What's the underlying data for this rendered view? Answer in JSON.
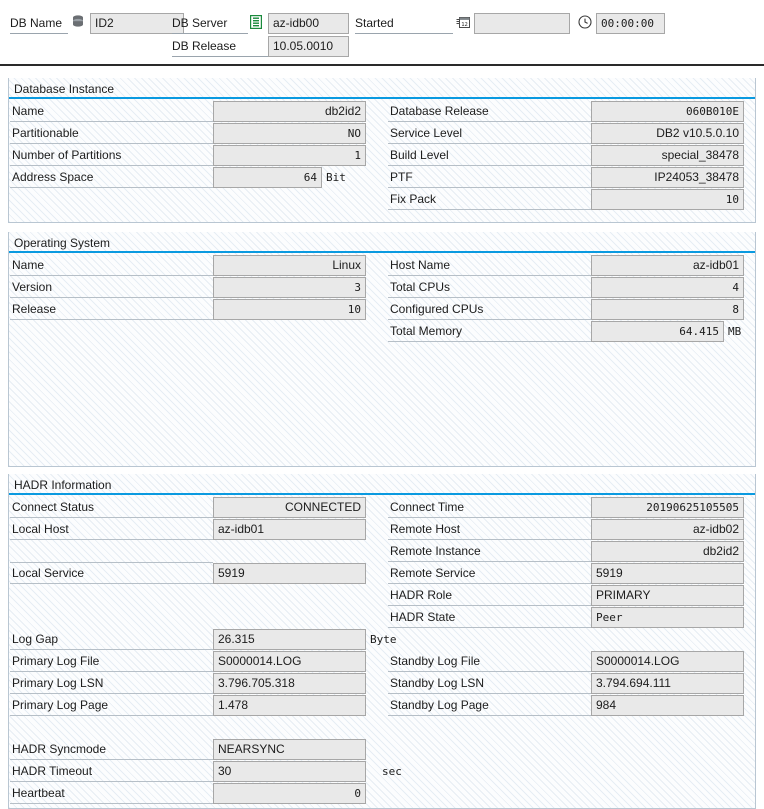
{
  "header": {
    "db_name_label": "DB Name",
    "db_name_icon": "database-icon",
    "db_name_value": "ID2",
    "db_server_label": "DB Server",
    "db_server_icon": "server-icon",
    "db_server_value": "az-idb00",
    "db_release_label": "DB Release",
    "db_release_value": "10.05.0010",
    "started_label": "Started",
    "started_icon": "calendar-icon",
    "started_date_value": "",
    "started_time_icon": "clock-icon",
    "started_time_value": "00:00:00"
  },
  "panels": [
    {
      "title": "Database Instance",
      "left_rows": [
        {
          "label": "Name",
          "value": "db2id2",
          "unit": ""
        },
        {
          "label": "Partitionable",
          "value": "NO",
          "unit": ""
        },
        {
          "label": "Number of Partitions",
          "value": "1",
          "unit": ""
        },
        {
          "label": "Address Space",
          "value": "64",
          "unit": "Bit"
        }
      ],
      "right_rows": [
        {
          "label": "Database Release",
          "value": "060B010E",
          "unit": ""
        },
        {
          "label": "Service Level",
          "value": "DB2 v10.5.0.10",
          "unit": ""
        },
        {
          "label": "Build Level",
          "value": "special_38478",
          "unit": ""
        },
        {
          "label": "PTF",
          "value": "IP24053_38478",
          "unit": ""
        },
        {
          "label": "Fix Pack",
          "value": "10",
          "unit": ""
        }
      ]
    },
    {
      "title": "Operating System",
      "left_rows": [
        {
          "label": "Name",
          "value": "Linux",
          "unit": ""
        },
        {
          "label": "Version",
          "value": "3",
          "unit": ""
        },
        {
          "label": "Release",
          "value": "10",
          "unit": ""
        }
      ],
      "right_rows": [
        {
          "label": "Host Name",
          "value": "az-idb01",
          "unit": ""
        },
        {
          "label": "Total CPUs",
          "value": "4",
          "unit": ""
        },
        {
          "label": "Configured CPUs",
          "value": "8",
          "unit": ""
        },
        {
          "label": "Total Memory",
          "value": "64.415",
          "unit": "MB"
        }
      ]
    },
    {
      "title": "HADR Information",
      "left_rows": [
        {
          "label": "Connect Status",
          "value": "CONNECTED",
          "unit": "",
          "align": "right"
        },
        {
          "label": "Local Host",
          "value": "az-idb01",
          "unit": "",
          "align": "left"
        },
        {
          "label": "",
          "value": "",
          "unit": "",
          "align": "left"
        },
        {
          "label": "Local Service",
          "value": "5919",
          "unit": "",
          "align": "left"
        },
        {
          "label": "",
          "value": "",
          "unit": "",
          "align": "left"
        },
        {
          "label": "",
          "value": "",
          "unit": "",
          "align": "left"
        },
        {
          "label": "Log Gap",
          "value": "26.315",
          "unit": "Byte",
          "align": "left"
        },
        {
          "label": "Primary Log File",
          "value": "S0000014.LOG",
          "unit": "",
          "align": "left"
        },
        {
          "label": "Primary Log LSN",
          "value": "3.796.705.318",
          "unit": "",
          "align": "left"
        },
        {
          "label": "Primary Log Page",
          "value": "1.478",
          "unit": "",
          "align": "left"
        },
        {
          "label": "",
          "value": "",
          "unit": "",
          "align": "left"
        },
        {
          "label": "HADR Syncmode",
          "value": "NEARSYNC",
          "unit": "",
          "align": "left"
        },
        {
          "label": "HADR Timeout",
          "value": "30",
          "unit": "sec",
          "align": "left"
        },
        {
          "label": "Heartbeat",
          "value": "0",
          "unit": "",
          "align": "right"
        }
      ],
      "right_rows": [
        {
          "label": "Connect Time",
          "value": "20190625105505",
          "unit": "",
          "align": "right"
        },
        {
          "label": "Remote Host",
          "value": "az-idb02",
          "unit": "",
          "align": "right"
        },
        {
          "label": "Remote Instance",
          "value": "db2id2",
          "unit": "",
          "align": "right"
        },
        {
          "label": "Remote Service",
          "value": "5919",
          "unit": "",
          "align": "left"
        },
        {
          "label": "HADR Role",
          "value": "PRIMARY",
          "unit": "",
          "align": "left"
        },
        {
          "label": "HADR State",
          "value": "Peer",
          "unit": "",
          "align": "left"
        },
        {
          "label": "",
          "value": "",
          "unit": "",
          "align": "left"
        },
        {
          "label": "Standby Log File",
          "value": "S0000014.LOG",
          "unit": "",
          "align": "left"
        },
        {
          "label": "Standby Log LSN",
          "value": "3.794.694.111",
          "unit": "",
          "align": "left"
        },
        {
          "label": "Standby Log Page",
          "value": "984",
          "unit": "",
          "align": "left"
        }
      ]
    }
  ],
  "colors": {
    "accent": "#0a9ae0",
    "field_bg": "#e9e9e9",
    "field_border": "#a7a7a7",
    "panel_border": "#b9c6d2",
    "icon_green": "#1a8a3c"
  }
}
